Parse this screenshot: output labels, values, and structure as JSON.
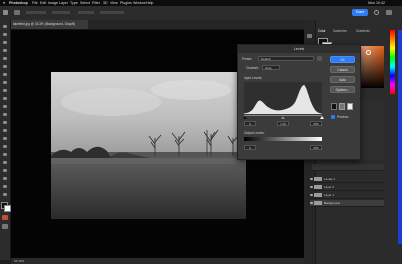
{
  "menubar": {
    "items": [
      "Photoshop",
      "File",
      "Edit",
      "Image",
      "Layer",
      "Type",
      "Select",
      "Filter",
      "3D",
      "View",
      "Plugins",
      "Window",
      "Help"
    ],
    "clock": "Mon 10:42"
  },
  "optionsbar": {
    "share_label": "Share"
  },
  "document": {
    "tab_title": "lakefield.jpg @ 33.3% (Background, Gray/8)",
    "status": "33.33%"
  },
  "panels": {
    "tabs": [
      "Color",
      "Swatches",
      "Gradients"
    ],
    "accent_color": "#2f7cf6",
    "layers": [
      {
        "name": "Levels 1"
      },
      {
        "name": "Layer 2"
      },
      {
        "name": "Layer 1"
      },
      {
        "name": "Background"
      }
    ]
  },
  "levels": {
    "title": "Levels",
    "preset_label": "Preset:",
    "preset_value": "Default",
    "channel_label": "Channel:",
    "channel_value": "Gray",
    "input_label": "Input Levels:",
    "input_values": [
      "0",
      "1.00",
      "255"
    ],
    "output_label": "Output Levels:",
    "output_values": [
      "0",
      "255"
    ],
    "buttons": [
      "OK",
      "Cancel",
      "Auto",
      "Options..."
    ],
    "preview_label": "Preview",
    "histogram": [
      2,
      3,
      5,
      9,
      16,
      28,
      40,
      46,
      42,
      35,
      27,
      22,
      18,
      15,
      13,
      12,
      12,
      13,
      15,
      17,
      20,
      24,
      30,
      40,
      58,
      78,
      92,
      98,
      84,
      62,
      40,
      24,
      12,
      6,
      3,
      1
    ]
  }
}
